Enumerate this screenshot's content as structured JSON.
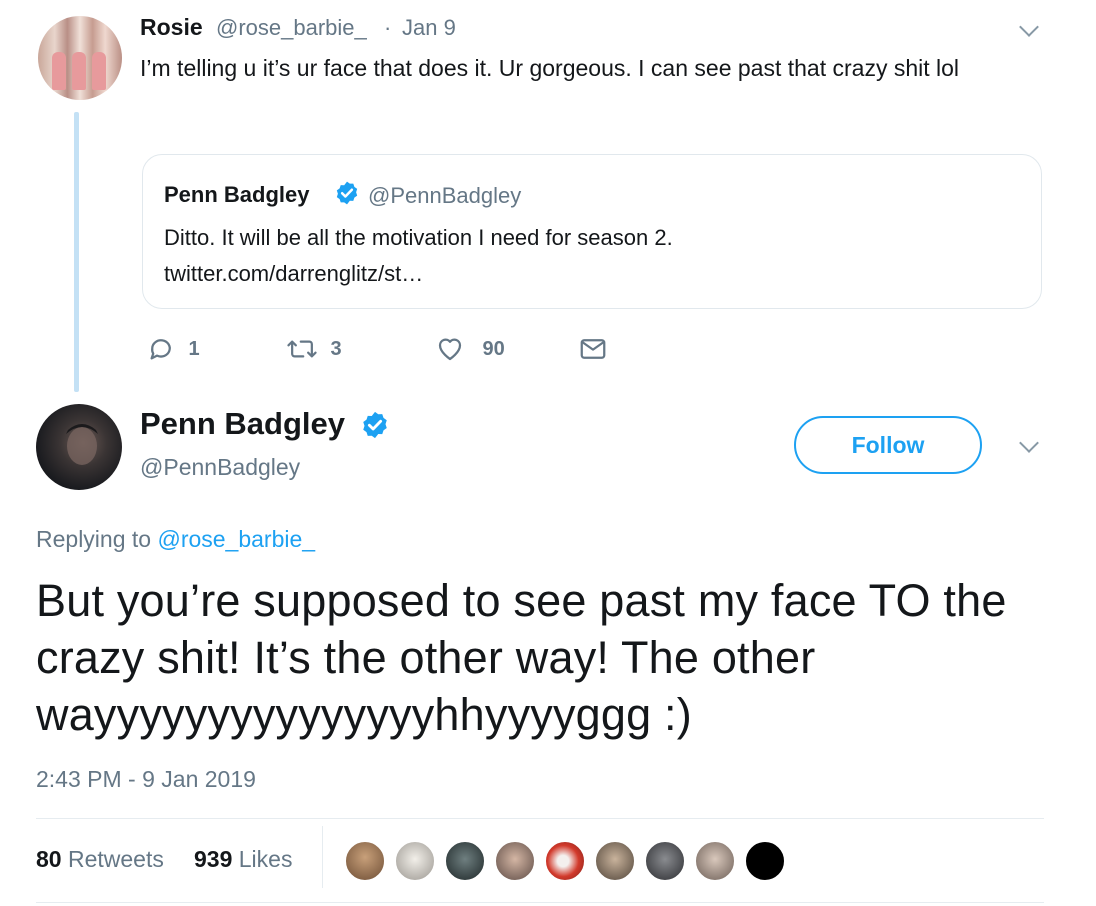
{
  "reply_tweet": {
    "author_name": "Rosie",
    "author_handle": "@rose_barbie_",
    "separator": "·",
    "date": "Jan 9",
    "text": "I’m telling u it’s ur face that does it. Ur gorgeous. I can see past that crazy shit lol",
    "quoted": {
      "author_name": "Penn Badgley",
      "author_handle": "@PennBadgley",
      "text_line1": "Ditto. It will be all the motivation I need for season 2.",
      "text_line2": "twitter.com/darrenglitz/st…"
    },
    "actions": {
      "reply_count": "1",
      "retweet_count": "3",
      "like_count": "90"
    }
  },
  "main_tweet": {
    "author_name": "Penn Badgley",
    "author_handle": "@PennBadgley",
    "follow_label": "Follow",
    "replying_prefix": "Replying to",
    "replying_to": "@rose_barbie_",
    "text": "But you’re supposed to see past my face TO the crazy shit! It’s the other way! The other wayyyyyyyyyyyyyyyhhyyyyggg :)",
    "timestamp": "2:43 PM - 9 Jan 2019",
    "retweets_count": "80",
    "retweets_label": "Retweets",
    "likes_count": "939",
    "likes_label": "Likes"
  },
  "colors": {
    "accent": "#1da1f2",
    "muted": "#657786",
    "text": "#14171a",
    "thread_line": "#c4e1f5",
    "border": "#e1e8ed"
  },
  "icons": [
    "reply-icon",
    "retweet-icon",
    "like-icon",
    "dm-icon",
    "verified-icon",
    "chevron-down-icon"
  ]
}
